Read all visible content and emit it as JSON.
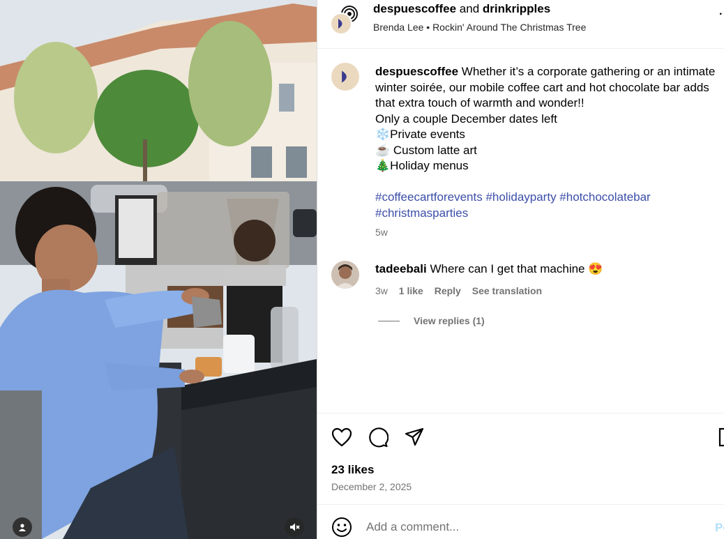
{
  "header": {
    "user1": "despuescoffee",
    "joiner": "and",
    "user2": "drinkripples",
    "audio": "Brenda Lee • Rockin' Around The Christmas Tree",
    "more_icon": "more-dots-icon"
  },
  "caption": {
    "username": "despuescoffee",
    "lines": [
      "Whether it’s a corporate gathering or an intimate",
      "winter soirée, our mobile coffee cart and hot chocolate bar adds",
      "that extra touch of warmth and wonder!!",
      "Only a couple December dates left",
      "❄️Private events",
      "☕ Custom latte art",
      "🎄Holiday menus"
    ],
    "hashtags_line1": "#coffeecartforevents #holidayparty #hotchocolatebar",
    "hashtags_line2": "#christmasparties",
    "time": "5w"
  },
  "comment": {
    "username": "tadeebali",
    "text": "Where can I get that machine 😍",
    "time": "3w",
    "likes": "1 like",
    "reply": "Reply",
    "translate": "See translation",
    "view_replies": "View replies (1)"
  },
  "actions": {
    "icons": [
      "heart-icon",
      "comment-icon",
      "share-icon",
      "bookmark-icon"
    ]
  },
  "likes": "23 likes",
  "date": "December 2, 2025",
  "comment_box": {
    "placeholder": "Add a comment...",
    "post_label": "Post"
  },
  "colors": {
    "hashtag": "#3b4ea8",
    "muted": "#737373",
    "post_disabled": "#b2dffc",
    "border": "#dbdbdb"
  }
}
